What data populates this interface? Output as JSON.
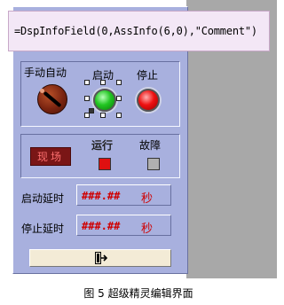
{
  "formula": "=DspInfoField(0,AssInfo(6,0),\"Comment\")",
  "control": {
    "manual_auto_label": "手动自动",
    "start_label": "启动",
    "stop_label": "停止"
  },
  "status": {
    "mode_text": "现场",
    "running_label": "运行",
    "fault_label": "故障"
  },
  "fields": {
    "start_delay_label": "启动延时",
    "start_delay_value": "###.##",
    "start_delay_unit": "秒",
    "stop_delay_label": "停止延时",
    "stop_delay_value": "###.##",
    "stop_delay_unit": "秒"
  },
  "caption": "图 5   超级精灵编辑界面",
  "icons": {
    "exit": "exit-door-icon"
  }
}
